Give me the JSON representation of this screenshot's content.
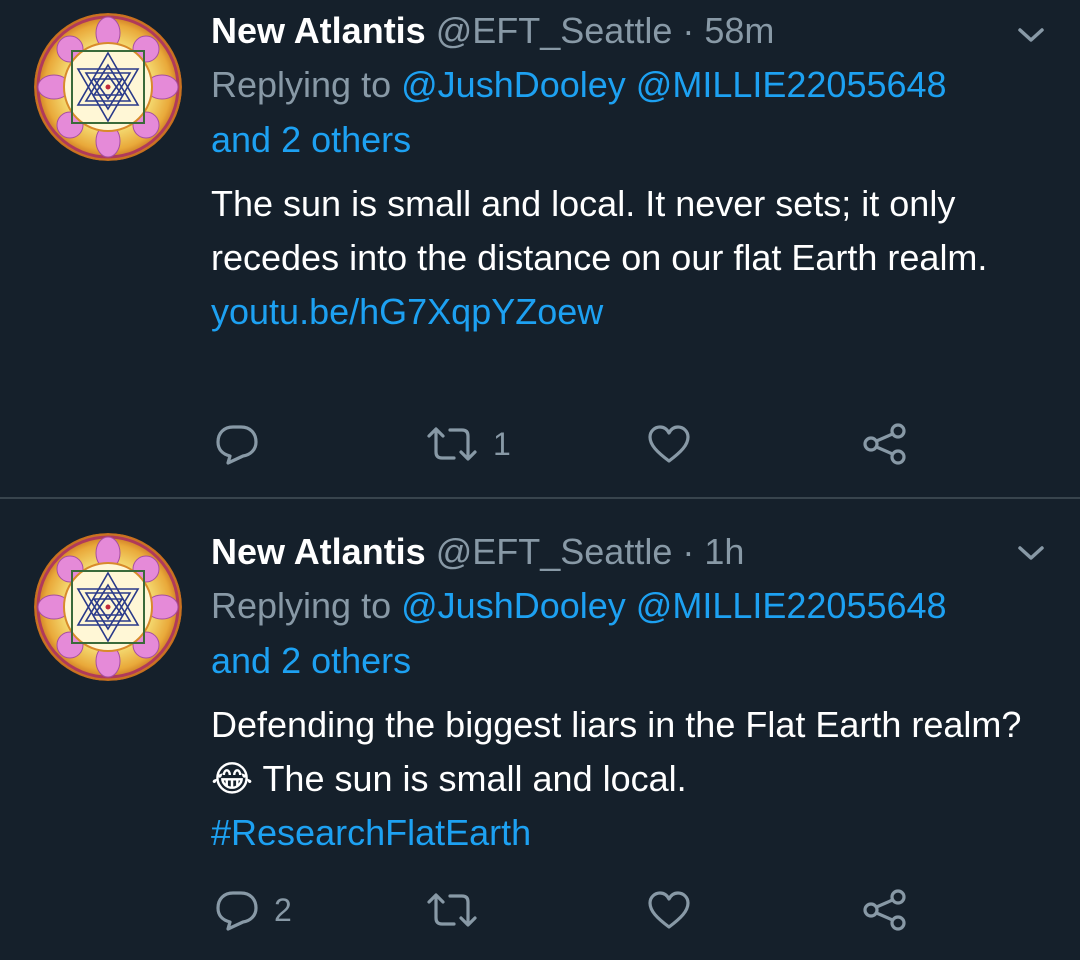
{
  "colors": {
    "background": "#15202b",
    "divider": "#38444d",
    "text_primary": "#ffffff",
    "text_secondary": "#8899a6",
    "link": "#1da1f2"
  },
  "tweets": [
    {
      "display_name": "New Atlantis",
      "handle": "@EFT_Seattle",
      "separator": "·",
      "time": "58m",
      "replying_to_prefix": "Replying to",
      "mention_1": "@JushDooley",
      "mention_2": "@MILLIE22055648",
      "others": "and 2 others",
      "text": "The sun is small and local. It never sets; it only recedes into the distance on our flat Earth realm.",
      "link": "youtu.be/hG7XqpYZoew",
      "reply_count": "",
      "retweet_count": "1",
      "like_count": "",
      "avatar_icon": "sri-yantra-avatar",
      "menu_icon": "chevron-down-icon"
    },
    {
      "display_name": "New Atlantis",
      "handle": "@EFT_Seattle",
      "separator": "·",
      "time": "1h",
      "replying_to_prefix": "Replying to",
      "mention_1": "@JushDooley",
      "mention_2": "@MILLIE22055648",
      "others": "and 2 others",
      "text_part1": "Defending the biggest liars in the Flat Earth realm?",
      "emoji": "😂",
      "text_part2": "The sun is small and local.",
      "hashtag": "#ResearchFlatEarth",
      "reply_count": "2",
      "retweet_count": "",
      "like_count": "",
      "avatar_icon": "sri-yantra-avatar",
      "menu_icon": "chevron-down-icon"
    }
  ]
}
